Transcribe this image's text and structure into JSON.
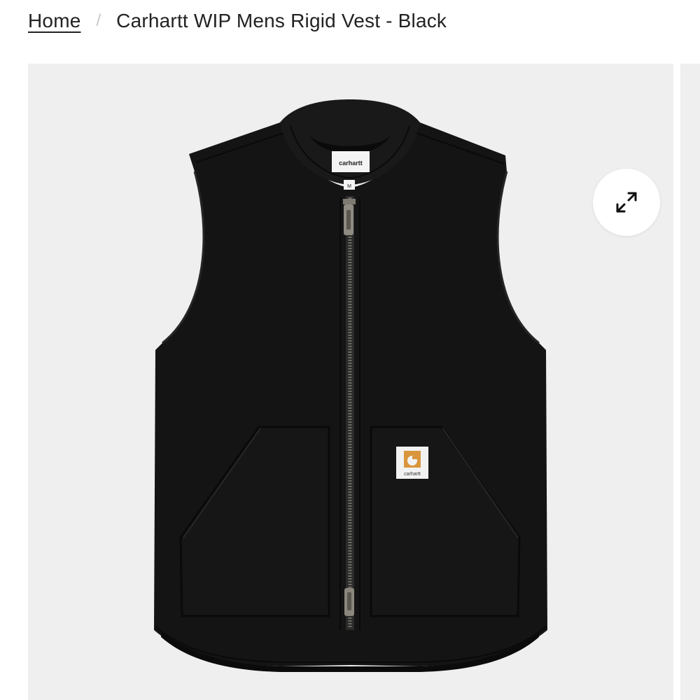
{
  "breadcrumb": {
    "home_label": "Home",
    "separator": "/",
    "current_label": "Carhartt WIP Mens Rigid Vest - Black"
  },
  "gallery": {
    "expand_icon": "expand-arrows-icon",
    "background_color": "#efefef"
  },
  "product_image": {
    "garment_color": "#141414",
    "neck_label_text": "carhartt",
    "size_tag_text": "M",
    "patch_text": "carhartt",
    "patch_logo_color": "#d9963c"
  }
}
